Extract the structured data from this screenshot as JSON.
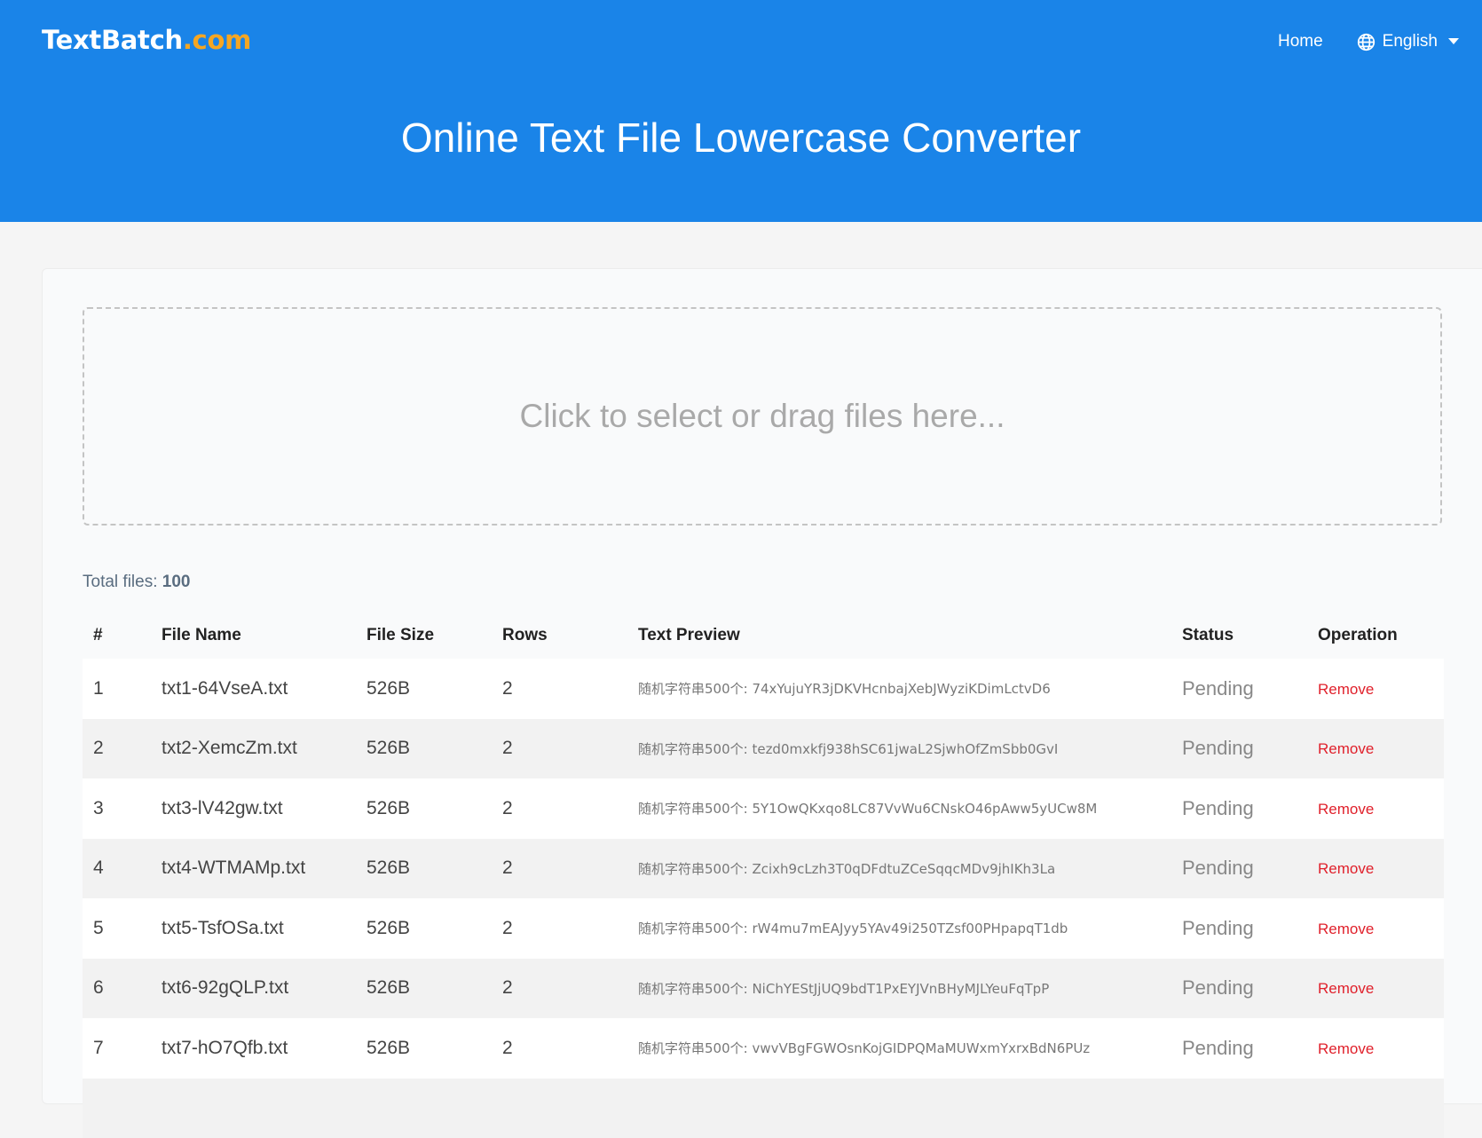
{
  "header": {
    "logo_main": "TextBatch",
    "logo_tld": ".com",
    "nav_home": "Home",
    "language": "English",
    "title": "Online Text File Lowercase Converter"
  },
  "upload": {
    "dropzone_text": "Click to select or drag files here..."
  },
  "summary": {
    "total_label": "Total files:",
    "total_value": "100"
  },
  "table": {
    "headers": [
      "#",
      "File Name",
      "File Size",
      "Rows",
      "Text Preview",
      "Status",
      "Operation"
    ],
    "rows": [
      {
        "num": "1",
        "name": "txt1-64VseA.txt",
        "size": "526B",
        "rows": "2",
        "preview": "随机字符串500个:  74xYujuYR3jDKVHcnbajXebJWyziKDimLctvD6",
        "status": "Pending",
        "op": "Remove"
      },
      {
        "num": "2",
        "name": "txt2-XemcZm.txt",
        "size": "526B",
        "rows": "2",
        "preview": "随机字符串500个:  tezd0mxkfj938hSC61jwaL2SjwhOfZmSbb0GvI",
        "status": "Pending",
        "op": "Remove"
      },
      {
        "num": "3",
        "name": "txt3-lV42gw.txt",
        "size": "526B",
        "rows": "2",
        "preview": "随机字符串500个:  5Y1OwQKxqo8LC87VvWu6CNskO46pAww5yUCw8M",
        "status": "Pending",
        "op": "Remove"
      },
      {
        "num": "4",
        "name": "txt4-WTMAMp.txt",
        "size": "526B",
        "rows": "2",
        "preview": "随机字符串500个:  Zcixh9cLzh3T0qDFdtuZCeSqqcMDv9jhIKh3La",
        "status": "Pending",
        "op": "Remove"
      },
      {
        "num": "5",
        "name": "txt5-TsfOSa.txt",
        "size": "526B",
        "rows": "2",
        "preview": "随机字符串500个:  rW4mu7mEAJyy5YAv49i250TZsf00PHpapqT1db",
        "status": "Pending",
        "op": "Remove"
      },
      {
        "num": "6",
        "name": "txt6-92gQLP.txt",
        "size": "526B",
        "rows": "2",
        "preview": "随机字符串500个:  NiChYEStJjUQ9bdT1PxEYJVnBHyMJLYeuFqTpP",
        "status": "Pending",
        "op": "Remove"
      },
      {
        "num": "7",
        "name": "txt7-hO7Qfb.txt",
        "size": "526B",
        "rows": "2",
        "preview": "随机字符串500个:  vwvVBgFGWOsnKojGIDPQMaMUWxmYxrxBdN6PUz",
        "status": "Pending",
        "op": "Remove"
      }
    ]
  },
  "colors": {
    "header_bg": "#1a84e8",
    "logo_accent": "#f5a623",
    "remove_link": "#e0202b"
  }
}
